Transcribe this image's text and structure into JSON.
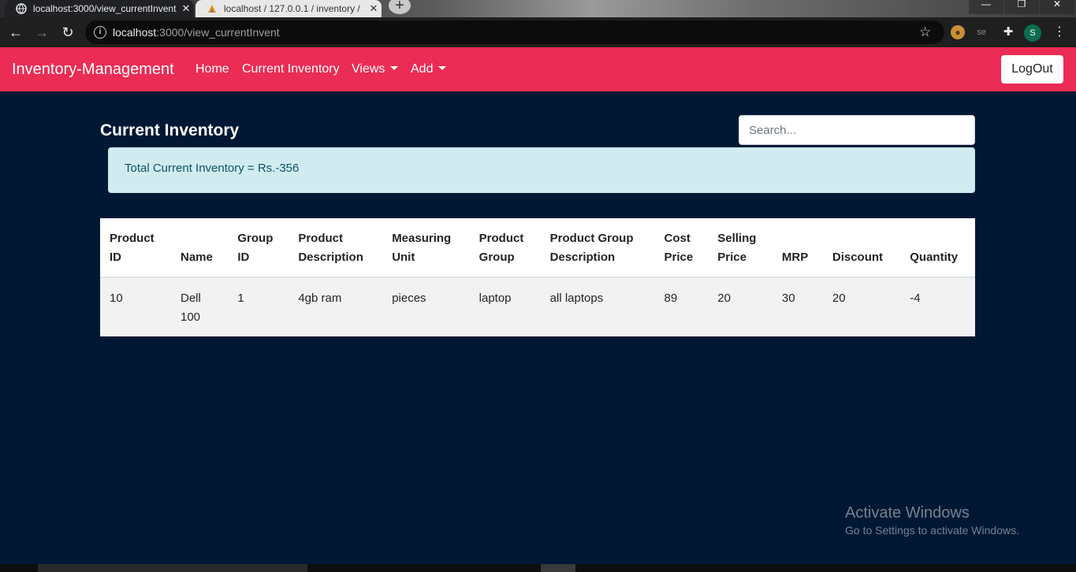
{
  "browser": {
    "tabs": [
      {
        "title": "localhost:3000/view_currentInvent",
        "active": true
      },
      {
        "title": "localhost / 127.0.0.1 / inventory /",
        "active": false
      }
    ],
    "new_tab": "+",
    "url_host": "localhost",
    "url_rest": ":3000/view_currentInvent",
    "extension_label": "se",
    "profile_initial": "S"
  },
  "navbar": {
    "brand": "Inventory-Management",
    "links": [
      "Home",
      "Current Inventory",
      "Views",
      "Add"
    ],
    "logout": "LogOut",
    "color": "#eb2c54"
  },
  "page": {
    "title": "Current Inventory",
    "search_placeholder": "Search...",
    "total_text": "Total Current Inventory = Rs.-356"
  },
  "table": {
    "headers": [
      [
        "Product",
        "ID"
      ],
      [
        "",
        "Name"
      ],
      [
        "Group",
        "ID"
      ],
      [
        "Product",
        "Description"
      ],
      [
        "Measuring",
        "Unit"
      ],
      [
        "Product",
        "Group"
      ],
      [
        "Product Group",
        "Description"
      ],
      [
        "Cost",
        "Price"
      ],
      [
        "Selling",
        "Price"
      ],
      [
        "",
        "MRP"
      ],
      [
        "",
        "Discount"
      ],
      [
        "",
        "Quantity"
      ]
    ],
    "rows": [
      [
        [
          "10"
        ],
        [
          "Dell",
          "100"
        ],
        [
          "1"
        ],
        [
          "4gb ram"
        ],
        [
          "pieces"
        ],
        [
          "laptop"
        ],
        [
          "all laptops"
        ],
        [
          "89"
        ],
        [
          "20"
        ],
        [
          "30"
        ],
        [
          "20"
        ],
        [
          "-4"
        ]
      ]
    ]
  },
  "watermark": {
    "title": "Activate Windows",
    "subtitle": "Go to Settings to activate Windows."
  },
  "colors": {
    "background": "#011834",
    "alert_bg": "#d1ecf1",
    "alert_text": "#0c5460"
  },
  "icons": [
    "back-arrow-icon",
    "forward-arrow-icon",
    "reload-icon",
    "info-icon",
    "star-icon",
    "cookie-icon",
    "puzzle-icon",
    "kebab-menu-icon",
    "close-icon",
    "caret-down-icon"
  ]
}
